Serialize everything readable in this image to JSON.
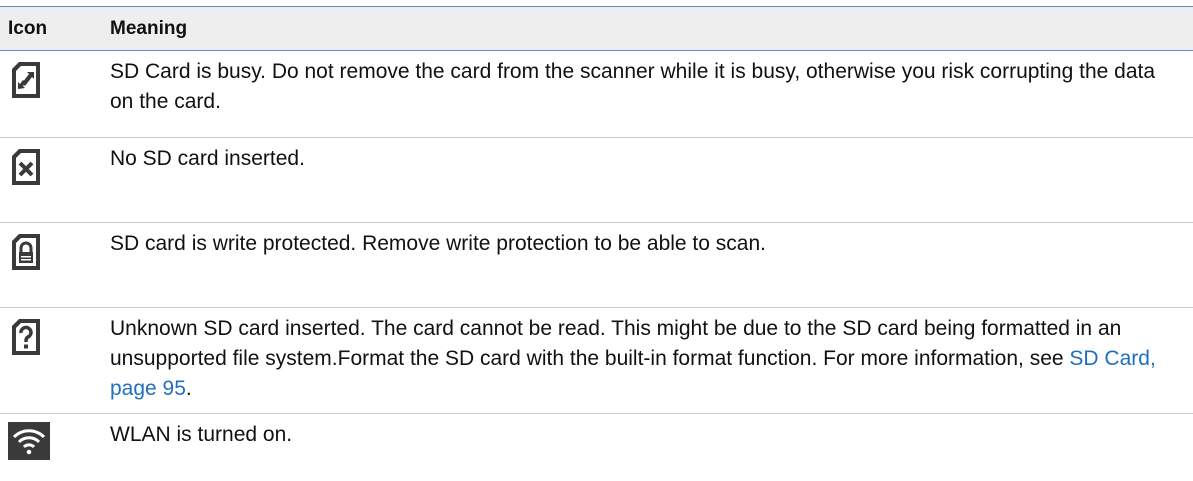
{
  "table": {
    "header": {
      "icon": "Icon",
      "meaning": "Meaning"
    },
    "rows": [
      {
        "icon": "sd-card-busy-icon",
        "text": "SD Card is busy. Do not remove the card from the scanner while it is busy, otherwise you risk corrupting the data on the card."
      },
      {
        "icon": "no-sd-card-icon",
        "text": "No SD card inserted."
      },
      {
        "icon": "sd-card-locked-icon",
        "text": "SD card is write protected. Remove write protection to be able to scan."
      },
      {
        "icon": "sd-card-unknown-icon",
        "text": "Unknown SD card inserted. The card cannot be read. This might be due to the SD card being formatted in an unsupported file system.Format the SD card with the built-in format function. For more information, see ",
        "link": "SD Card, page 95",
        "text_after": "."
      },
      {
        "icon": "wlan-icon",
        "text": "WLAN is turned on."
      }
    ]
  },
  "colors": {
    "icon_bg": "#3a3a3a",
    "link": "#1f6fbf",
    "header_border": "#5b8fc7"
  }
}
